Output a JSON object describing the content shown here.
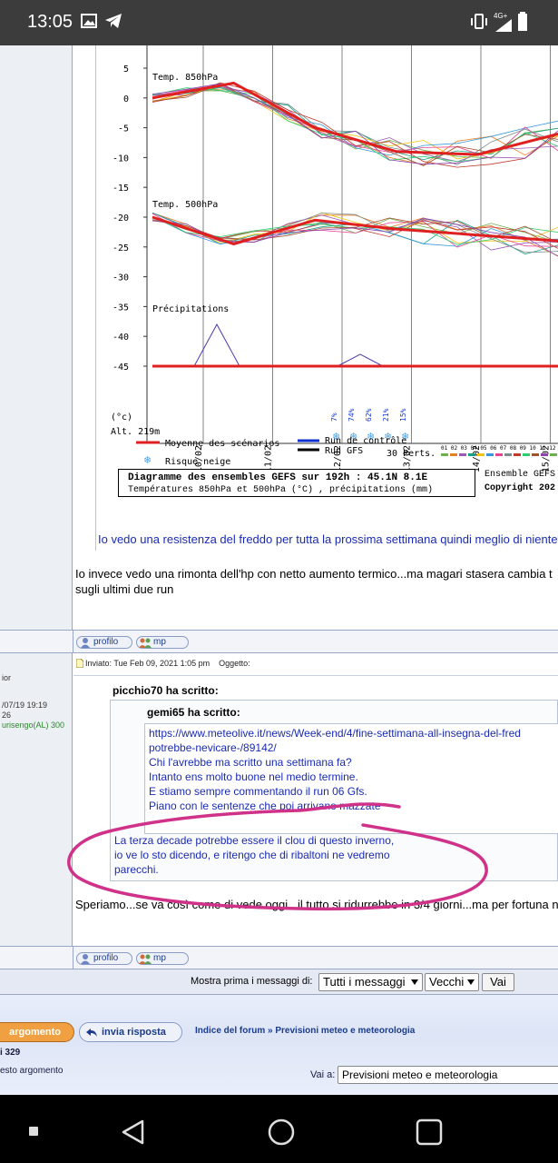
{
  "status_bar": {
    "time": "13:05",
    "network": "4G+"
  },
  "chart": {
    "y_ticks": [
      "5",
      "0",
      "-5",
      "-10",
      "-15",
      "-20",
      "-25",
      "-30",
      "-35",
      "-40",
      "-45"
    ],
    "y_unit": "(°c)",
    "altitude": "Alt. 219m",
    "x_ticks": [
      "10/02",
      "11/02",
      "12/02",
      "13/02",
      "14/02",
      "15/02"
    ],
    "section_labels": [
      "Temp. 850hPa",
      "Temp. 500hPa",
      "Précipitations"
    ],
    "snow_risk_pct": [
      "7%",
      "74%",
      "62%",
      "21%",
      "15%"
    ],
    "legend": {
      "mean": "Moyenne des scénarios",
      "control": "Run de contrôle",
      "gfs": "Run GFS",
      "snow": "Risque neige",
      "perts": "30 Perts.",
      "pert_numbers": "01 02 03 04 05 06 07 08 09 10 11 12 1"
    },
    "caption_title": "Diagramme des ensembles GEFS sur 192h : 45.1N 8.1E",
    "caption_sub": "Températures 850hPa et 500hPa (°C) , précipitations (mm)",
    "caption_right_1": "Ensemble GEFS c",
    "caption_right_2": "Copyright 202"
  },
  "chart_data": {
    "type": "line",
    "x": [
      "10/02",
      "11/02",
      "12/02",
      "13/02",
      "14/02",
      "15/02"
    ],
    "ylim": [
      -47,
      5
    ],
    "series": [
      {
        "name": "Moyenne des scénarios",
        "values": [
          0,
          2.5,
          -5,
          -9,
          -9.5,
          -6
        ]
      },
      {
        "name": "Moyenne des scénarios",
        "values": [
          -20,
          -24.5,
          -20.5,
          -22,
          -23,
          -24
        ]
      },
      {
        "name": "Moyenne des scénarios",
        "values": [
          -45,
          -45,
          -45,
          -45,
          -45,
          -45
        ]
      }
    ]
  },
  "post1": {
    "quote_text": "Io vedo una resistenza del freddo per tutta la prossima settimana quindi meglio di niente",
    "body_1": "Io invece vedo una rimonta dell'hp con netto aumento termico...ma magari stasera cambia t",
    "body_2": "sugli ultimi due run"
  },
  "buttons": {
    "profile": "profilo",
    "pm": "mp"
  },
  "post2": {
    "author_rank": "ior",
    "author_date": "/07/19 19:19",
    "author_posts": "26",
    "author_loc": "urisengo(AL) 300",
    "meta": "Inviato: Tue Feb 09, 2021 1:05 pm    Oggetto:",
    "q1_author": "picchio70 ha scritto:",
    "q2_author": "gemi65 ha scritto:",
    "q2_lines": [
      "https://www.meteolive.it/news/Week-end/4/fine-settimana-all-insegna-del-fred",
      "potrebbe-nevicare-/89142/",
      "Chi l'avrebbe ma scritto una settimana fa?",
      "Intanto ens molto buone nel medio termine.",
      "E stiamo sempre commentando il run 06 Gfs.",
      "Piano con le sentenze che poi arrivano mazzate"
    ],
    "q1_lines": [
      "La terza decade potrebbe essere il clou di questo inverno,",
      "io ve lo sto dicendo, e ritengo che di ribaltoni ne vedremo",
      "parecchi."
    ],
    "body": "Speriamo...se va così come di vede oggi...il tutto si ridurrebbe in 3/4 giorni...ma per fortuna n"
  },
  "sort": {
    "label": "Mostra prima i messaggi di:",
    "all": "Tutti i messaggi",
    "order": "Vecchi",
    "go": "Vai"
  },
  "footer": {
    "new_topic": "argomento",
    "reply": "invia risposta",
    "breadcrumb": "Indice del forum » Previsioni meteo e meteorologia",
    "page_info": "i 329",
    "topic_link": "esto argomento",
    "jump_label": "Vai a:",
    "jump_value": "Previsioni meteo e meteorologia"
  },
  "colors": {
    "accent": "#1a2bb0",
    "mean": "#e02020",
    "annotation": "#d0328a"
  }
}
